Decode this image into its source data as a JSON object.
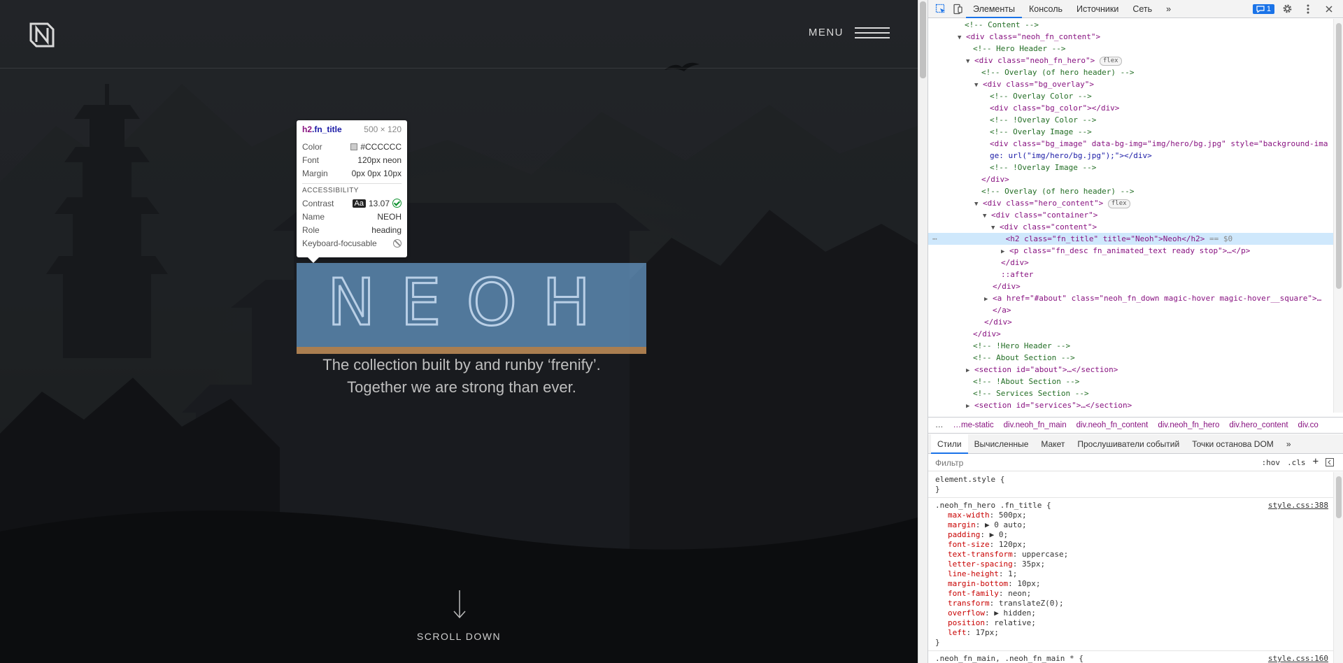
{
  "site": {
    "menu_label": "MENU",
    "hero_title": "NEOH",
    "hero_desc_line1": "The collection built by and runby ‘frenify’.",
    "hero_desc_line2": "Together we are strong than ever.",
    "scroll_label": "SCROLL DOWN"
  },
  "tooltip": {
    "tag": "h2",
    "cls": ".fn_title",
    "dims": "500 × 120",
    "color_label": "Color",
    "color_value": "#CCCCCC",
    "font_label": "Font",
    "font_value": "120px neon",
    "margin_label": "Margin",
    "margin_value": "0px 0px 10px",
    "accessibility_label": "ACCESSIBILITY",
    "contrast_label": "Contrast",
    "contrast_aa": "Aa",
    "contrast_value": "13.07",
    "name_label": "Name",
    "name_value": "NEOH",
    "role_label": "Role",
    "role_value": "heading",
    "keyboard_label": "Keyboard-focusable"
  },
  "devtools": {
    "tabs": [
      "Элементы",
      "Консоль",
      "Источники",
      "Сеть"
    ],
    "more": "»",
    "issues_count": "1",
    "dom": [
      {
        "c": "<!-- Content -->"
      },
      {
        "o": "<div class=\"neoh_fn_content\">"
      },
      {
        "c": "<!-- Hero Header -->"
      },
      {
        "o": "<div class=\"neoh_fn_hero\">",
        "flex": "flex"
      },
      {
        "c": "<!-- Overlay (of hero header) -->"
      },
      {
        "o": "<div class=\"bg_overlay\">"
      },
      {
        "c": "<!-- Overlay Color -->"
      },
      {
        "o": "<div class=\"bg_color\"></div>"
      },
      {
        "c": "<!-- !Overlay Color -->"
      },
      {
        "c": "<!-- Overlay Image -->"
      },
      {
        "o": "<div class=\"bg_image\" data-bg-img=\"img/hero/bg.jpg\" style=\"background-ima"
      },
      {
        "o": "ge: url(\"img/hero/bg.jpg\");\"></div>"
      },
      {
        "c": "<!-- !Overlay Image -->"
      },
      {
        "o": "</div>"
      },
      {
        "c": "<!-- Overlay (of hero header) -->"
      },
      {
        "o": "<div class=\"hero_content\">",
        "flex": "flex"
      },
      {
        "o": "<div class=\"container\">"
      },
      {
        "o": "<div class=\"content\">"
      },
      {
        "o": "<h2 class=\"fn_title\" title=\"Neoh\">Neoh</h2>",
        "tail": "== $0"
      },
      {
        "o": "<p class=\"fn_desc fn_animated_text ready stop\">…</p>"
      },
      {
        "o": "</div>"
      },
      {
        "o": "::after"
      },
      {
        "o": "</div>"
      },
      {
        "o": "<a href=\"#about\" class=\"neoh_fn_down magic-hover magic-hover__square\">…"
      },
      {
        "o": "</a>"
      },
      {
        "o": "</div>"
      },
      {
        "o": "</div>"
      },
      {
        "c": "<!-- !Hero Header -->"
      },
      {
        "c": "<!-- About Section -->"
      },
      {
        "o": "<section id=\"about\">…</section>"
      },
      {
        "c": "<!-- !About Section -->"
      },
      {
        "c": "<!-- Services Section -->"
      },
      {
        "o": "<section id=\"services\">…</section>"
      }
    ],
    "crumbs": [
      "…me-static",
      "div.neoh_fn_main",
      "div.neoh_fn_content",
      "div.neoh_fn_hero",
      "div.hero_content",
      "div.co"
    ],
    "crumbs_more": "…",
    "subtabs": [
      "Стили",
      "Вычисленные",
      "Макет",
      "Прослушиватели событий",
      "Точки останова DOM"
    ],
    "filter_placeholder": "Фильтр",
    "filter_hov": ":hov",
    "filter_cls": ".cls",
    "element_style": "element.style {",
    "close_brace": "}",
    "rule_selector": ".neoh_fn_hero .fn_title {",
    "rule_source": "style.css:388",
    "props": [
      {
        "n": "max-width",
        "v": "500px;"
      },
      {
        "n": "margin",
        "v": "▶ 0 auto;"
      },
      {
        "n": "padding",
        "v": "▶ 0;"
      },
      {
        "n": "font-size",
        "v": "120px;"
      },
      {
        "n": "text-transform",
        "v": "uppercase;"
      },
      {
        "n": "letter-spacing",
        "v": "35px;"
      },
      {
        "n": "line-height",
        "v": "1;"
      },
      {
        "n": "margin-bottom",
        "v": "10px;"
      },
      {
        "n": "font-family",
        "v": "neon;"
      },
      {
        "n": "transform",
        "v": "translateZ(0);"
      },
      {
        "n": "overflow",
        "v": "▶ hidden;"
      },
      {
        "n": "position",
        "v": "relative;"
      },
      {
        "n": "left",
        "v": "17px;"
      }
    ],
    "next_selector": ".neoh_fn_main, .neoh_fn_main * {",
    "next_source": "style.css:160"
  }
}
